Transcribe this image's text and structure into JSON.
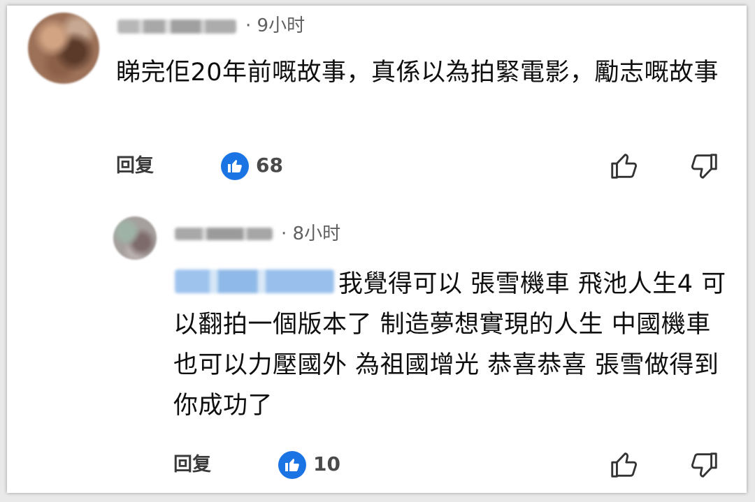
{
  "comment": {
    "time": "· 9小时",
    "text": "睇完佢20年前嘅故事，真係以為拍緊電影，勵志嘅故事",
    "reply_label": "回复",
    "likes": "68"
  },
  "reply": {
    "time": "· 8小时",
    "text": "我覺得可以 張雪機車 飛池人生4 可以翻拍一個版本了 制造夢想實現的人生 中國機車也可以力壓國外 為祖國增光 恭喜恭喜 張雪做得到 你成功了",
    "reply_label": "回复",
    "likes": "10"
  },
  "icons": {
    "like_badge": "thumb-up-filled-icon",
    "like": "thumb-up-outline-icon",
    "dislike": "thumb-down-outline-icon"
  },
  "colors": {
    "like_badge": "#1b74e4",
    "text": "#0f0f0f",
    "meta": "#606060"
  }
}
